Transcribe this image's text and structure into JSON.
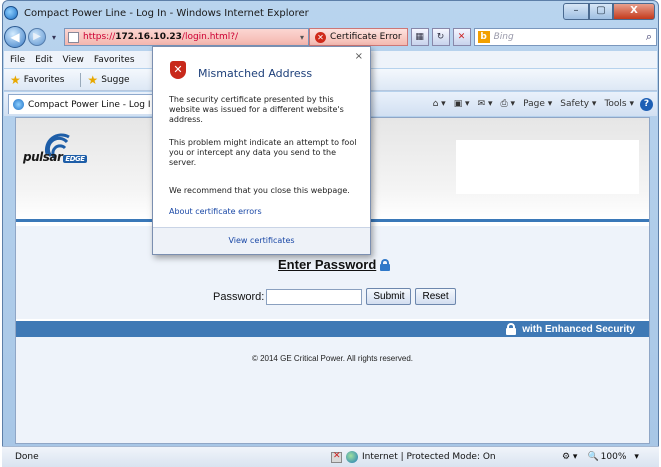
{
  "window": {
    "title": "Compact Power Line - Log In - Windows Internet Explorer",
    "min": "–",
    "max": "▢",
    "close": "X"
  },
  "nav": {
    "address_scheme": "https://",
    "address_host": "172.16.10.23",
    "address_path": "/login.html?/",
    "cert_error": "Certificate Error",
    "search_placeholder": "Bing"
  },
  "menu": [
    "File",
    "Edit",
    "View",
    "Favorites"
  ],
  "favorites": {
    "label": "Favorites",
    "suggested": "Sugge"
  },
  "tab": {
    "label": "Compact Power Line - Log I"
  },
  "commands": {
    "page": "Page ▾",
    "safety": "Safety ▾",
    "tools": "Tools ▾"
  },
  "popup": {
    "title": "Mismatched Address",
    "para1": "The security certificate presented by this website was issued for a different website's address.",
    "para2": "This problem might indicate an attempt to fool you or intercept any data you send to the server.",
    "para3": "We recommend that you close this webpage.",
    "link": "About certificate errors",
    "footer": "View certificates",
    "close": "×"
  },
  "page": {
    "logo_word": "pulsar",
    "logo_edge": "EDGE",
    "heading": "Enter Password",
    "password_label": "Password:",
    "submit": "Submit",
    "reset": "Reset",
    "security_banner": "with Enhanced Security",
    "copyright": "© 2014 GE Critical Power. All rights reserved."
  },
  "status": {
    "left": "Done",
    "zone": "Internet | Protected Mode: On",
    "zoom": "100%"
  },
  "colors": {
    "accent": "#3f79b5",
    "error": "#c8291b"
  }
}
